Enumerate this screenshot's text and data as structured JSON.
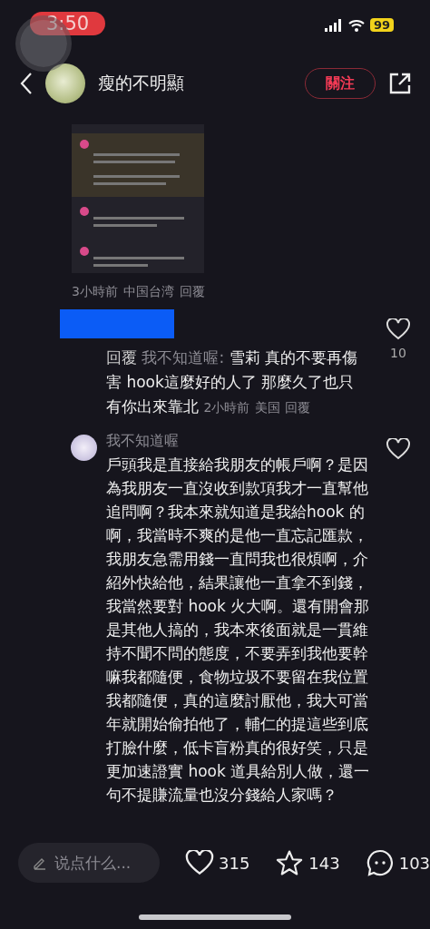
{
  "status_bar": {
    "time": "3:50",
    "battery": "99"
  },
  "header": {
    "username": "瘦的不明顯",
    "follow_button": "關注"
  },
  "image_comment": {
    "time": "3小時前",
    "location": "中国台湾",
    "reply": "回覆"
  },
  "comments": [
    {
      "kind": "reply",
      "redacted": true,
      "reply_label": "回覆",
      "reply_to": "我不知道喔:",
      "text": "雪莉 真的不要再傷害 hook這麼好的人了 那麼久了也只有你出來靠北",
      "time": "2小時前",
      "location": "美国",
      "reply": "回覆",
      "likes": "10"
    },
    {
      "kind": "comment",
      "username": "我不知道喔",
      "text": "戶頭我是直接給我朋友的帳戶啊？是因為我朋友一直沒收到款項我才一直幫他追問啊？我本來就知道是我給hook 的啊，我當時不爽的是他一直忘記匯款，我朋友急需用錢一直問我也很煩啊，介紹外快給他，結果讓他一直拿不到錢，我當然要對 hook 火大啊。還有開會那是其他人搞的，我本來後面就是一貫維持不聞不問的態度，不要弄到我他要幹嘛我都隨便，食物垃圾不要留在我位置我都隨便，真的這麼討厭他，我大可當年就開始偷拍他了，輔仁的提這些到底打臉什麼，低卡盲粉真的很好笑，只是更加速證實 hook 道具給別人做，還一句不提賺流量也沒分錢給人家嗎？"
    }
  ],
  "bottom_bar": {
    "input_placeholder": "说点什么...",
    "likes": "315",
    "favorites": "143",
    "comments": "103"
  }
}
